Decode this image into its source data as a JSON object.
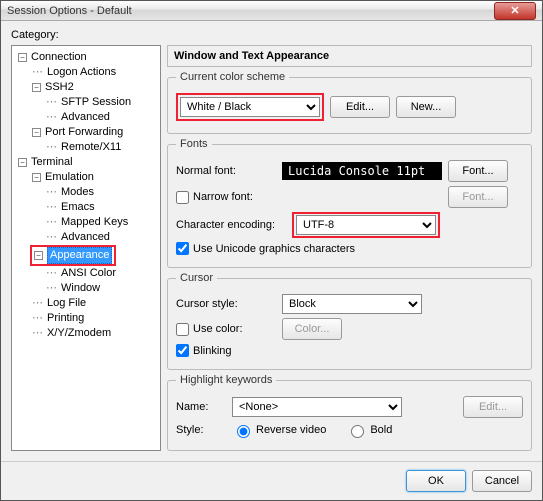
{
  "title": "Session Options - Default",
  "category_label": "Category:",
  "tree": {
    "connection": "Connection",
    "logon_actions": "Logon Actions",
    "ssh2": "SSH2",
    "sftp_session": "SFTP Session",
    "advanced1": "Advanced",
    "port_forwarding": "Port Forwarding",
    "remote_x11": "Remote/X11",
    "terminal": "Terminal",
    "emulation": "Emulation",
    "modes": "Modes",
    "emacs": "Emacs",
    "mapped_keys": "Mapped Keys",
    "advanced2": "Advanced",
    "appearance": "Appearance",
    "ansi_color": "ANSI Color",
    "window": "Window",
    "log_file": "Log File",
    "printing": "Printing",
    "xyzmodem": "X/Y/Zmodem"
  },
  "header": "Window and Text Appearance",
  "scheme": {
    "legend": "Current color scheme",
    "value": "White / Black",
    "edit": "Edit...",
    "new": "New..."
  },
  "fonts": {
    "legend": "Fonts",
    "normal_lbl": "Normal font:",
    "normal_val": "Lucida Console 11pt",
    "font_btn": "Font...",
    "narrow_chk": "Narrow font:",
    "font_btn2": "Font...",
    "enc_lbl": "Character encoding:",
    "enc_val": "UTF-8",
    "unicode_chk": "Use Unicode graphics characters"
  },
  "cursor": {
    "legend": "Cursor",
    "style_lbl": "Cursor style:",
    "style_val": "Block",
    "usecolor_chk": "Use color:",
    "color_btn": "Color...",
    "blinking_chk": "Blinking"
  },
  "hk": {
    "legend": "Highlight keywords",
    "name_lbl": "Name:",
    "name_val": "<None>",
    "edit_btn": "Edit...",
    "style_lbl": "Style:",
    "reverse": "Reverse video",
    "bold": "Bold"
  },
  "buttons": {
    "ok": "OK",
    "cancel": "Cancel"
  }
}
